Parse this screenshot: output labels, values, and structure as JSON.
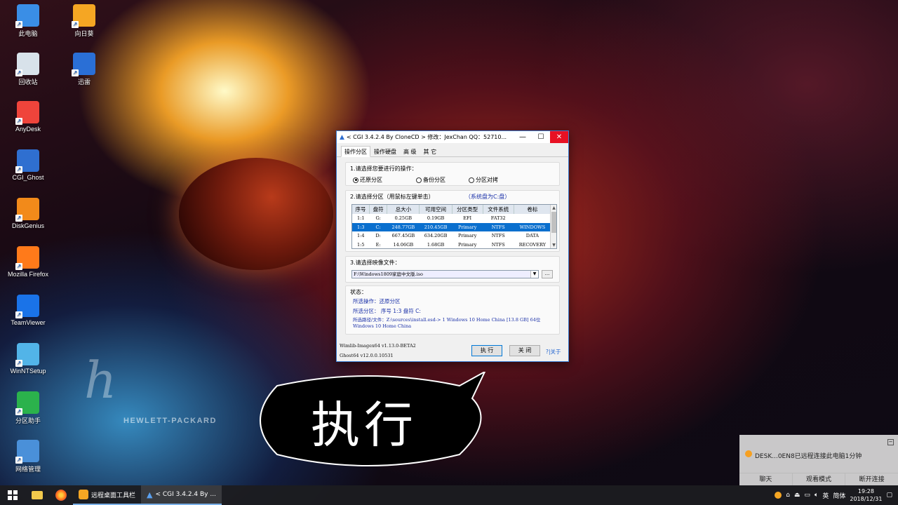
{
  "desktop": {
    "icons_left": [
      {
        "label": "此电脑",
        "name": "this-pc-icon",
        "color": "#3a8ee6"
      },
      {
        "label": "回收站",
        "name": "recycle-bin-icon",
        "color": "#d8e2ea"
      },
      {
        "label": "AnyDesk",
        "name": "anydesk-icon",
        "color": "#ef443b"
      },
      {
        "label": "CGI_Ghost",
        "name": "cgi-ghost-icon",
        "color": "#2f6fd0"
      },
      {
        "label": "DiskGenius",
        "name": "diskgenius-icon",
        "color": "#f28a1a"
      },
      {
        "label": "Mozilla Firefox",
        "name": "firefox-icon",
        "color": "#ff7a1a"
      },
      {
        "label": "TeamViewer",
        "name": "teamviewer-icon",
        "color": "#1a73e8"
      },
      {
        "label": "WinNTSetup",
        "name": "winntsetup-icon",
        "color": "#52b4e8"
      },
      {
        "label": "分区助手",
        "name": "partition-assistant-icon",
        "color": "#2bb24c"
      },
      {
        "label": "网络管理",
        "name": "network-manager-icon",
        "color": "#4a90d9"
      }
    ],
    "icons_right": [
      {
        "label": "向日葵",
        "name": "sunflower-icon",
        "color": "#f5a623"
      },
      {
        "label": "迅雷",
        "name": "thunder-icon",
        "color": "#2a6fd6"
      }
    ],
    "brand_text": "HEWLETT-PACKARD"
  },
  "window": {
    "title": "< CGI 3.4.2.4 By CloneCD > 修改：JexChan  QQ：52710...",
    "minimize": "—",
    "maximize": "☐",
    "close": "✕",
    "tabs": [
      "操作分区",
      "操作硬盘",
      "高 级",
      "其 它"
    ],
    "active_tab": 0,
    "section1": {
      "label": "1.请选择您要进行的操作：",
      "options": [
        {
          "label": "还原分区",
          "checked": true
        },
        {
          "label": "备份分区",
          "checked": false
        },
        {
          "label": "分区对拷",
          "checked": false
        }
      ]
    },
    "section2": {
      "label": "2.请选择分区（用鼠标左键单击）",
      "system_disk": "（系统盘为C:盘）",
      "headers": [
        "序号",
        "盘符",
        "总大小",
        "可用空间",
        "分区类型",
        "文件系统",
        "卷标"
      ],
      "rows": [
        [
          "1:1",
          "G:",
          "0.25GB",
          "0.19GB",
          "EFI",
          "FAT32",
          ""
        ],
        [
          "1:3",
          "C:",
          "248.77GB",
          "210.45GB",
          "Primary",
          "NTFS",
          "WINDOWS"
        ],
        [
          "1:4",
          "D:",
          "667.45GB",
          "634.20GB",
          "Primary",
          "NTFS",
          "DATA"
        ],
        [
          "1:5",
          "E:",
          "14.06GB",
          "1.68GB",
          "Primary",
          "NTFS",
          "RECOVERY"
        ]
      ],
      "selected_row": 1
    },
    "section3": {
      "label": "3.请选择映像文件：",
      "value": "F:\\Windows1809家庭中文版.iso",
      "browse": "..."
    },
    "status": {
      "label": "状态：",
      "operation": "所选操作：还原分区",
      "partition": "所选分区：  序号 1:3        盘符 C:",
      "path": "所选路径/文件：Z:\\sources\\install.esd-> 1 Windows 10 Home China [13.8 GB] 64位 Windows 10 Home China"
    },
    "footer": {
      "wimlib": "Wimlib-Imagex64 v1.13.0-BETA2",
      "ghost": "Ghost64 v12.0.0.10531"
    },
    "buttons": {
      "execute": "执 行",
      "close": "关 闭",
      "about": "?|关于"
    }
  },
  "bubble": {
    "text": "执行"
  },
  "notification": {
    "message": "DESK...0EN8已远程连接此电脑1分钟",
    "actions": [
      "聊天",
      "观看模式",
      "断开连接"
    ]
  },
  "taskbar": {
    "apps": [
      {
        "label": "远程桌面工具栏",
        "active": false
      },
      {
        "label": "< CGI 3.4.2.4 By ...",
        "active": true
      }
    ],
    "tray": {
      "ime_lang": "英",
      "ime_mode": "简体",
      "time": "19:28",
      "date": "2018/12/31"
    }
  }
}
